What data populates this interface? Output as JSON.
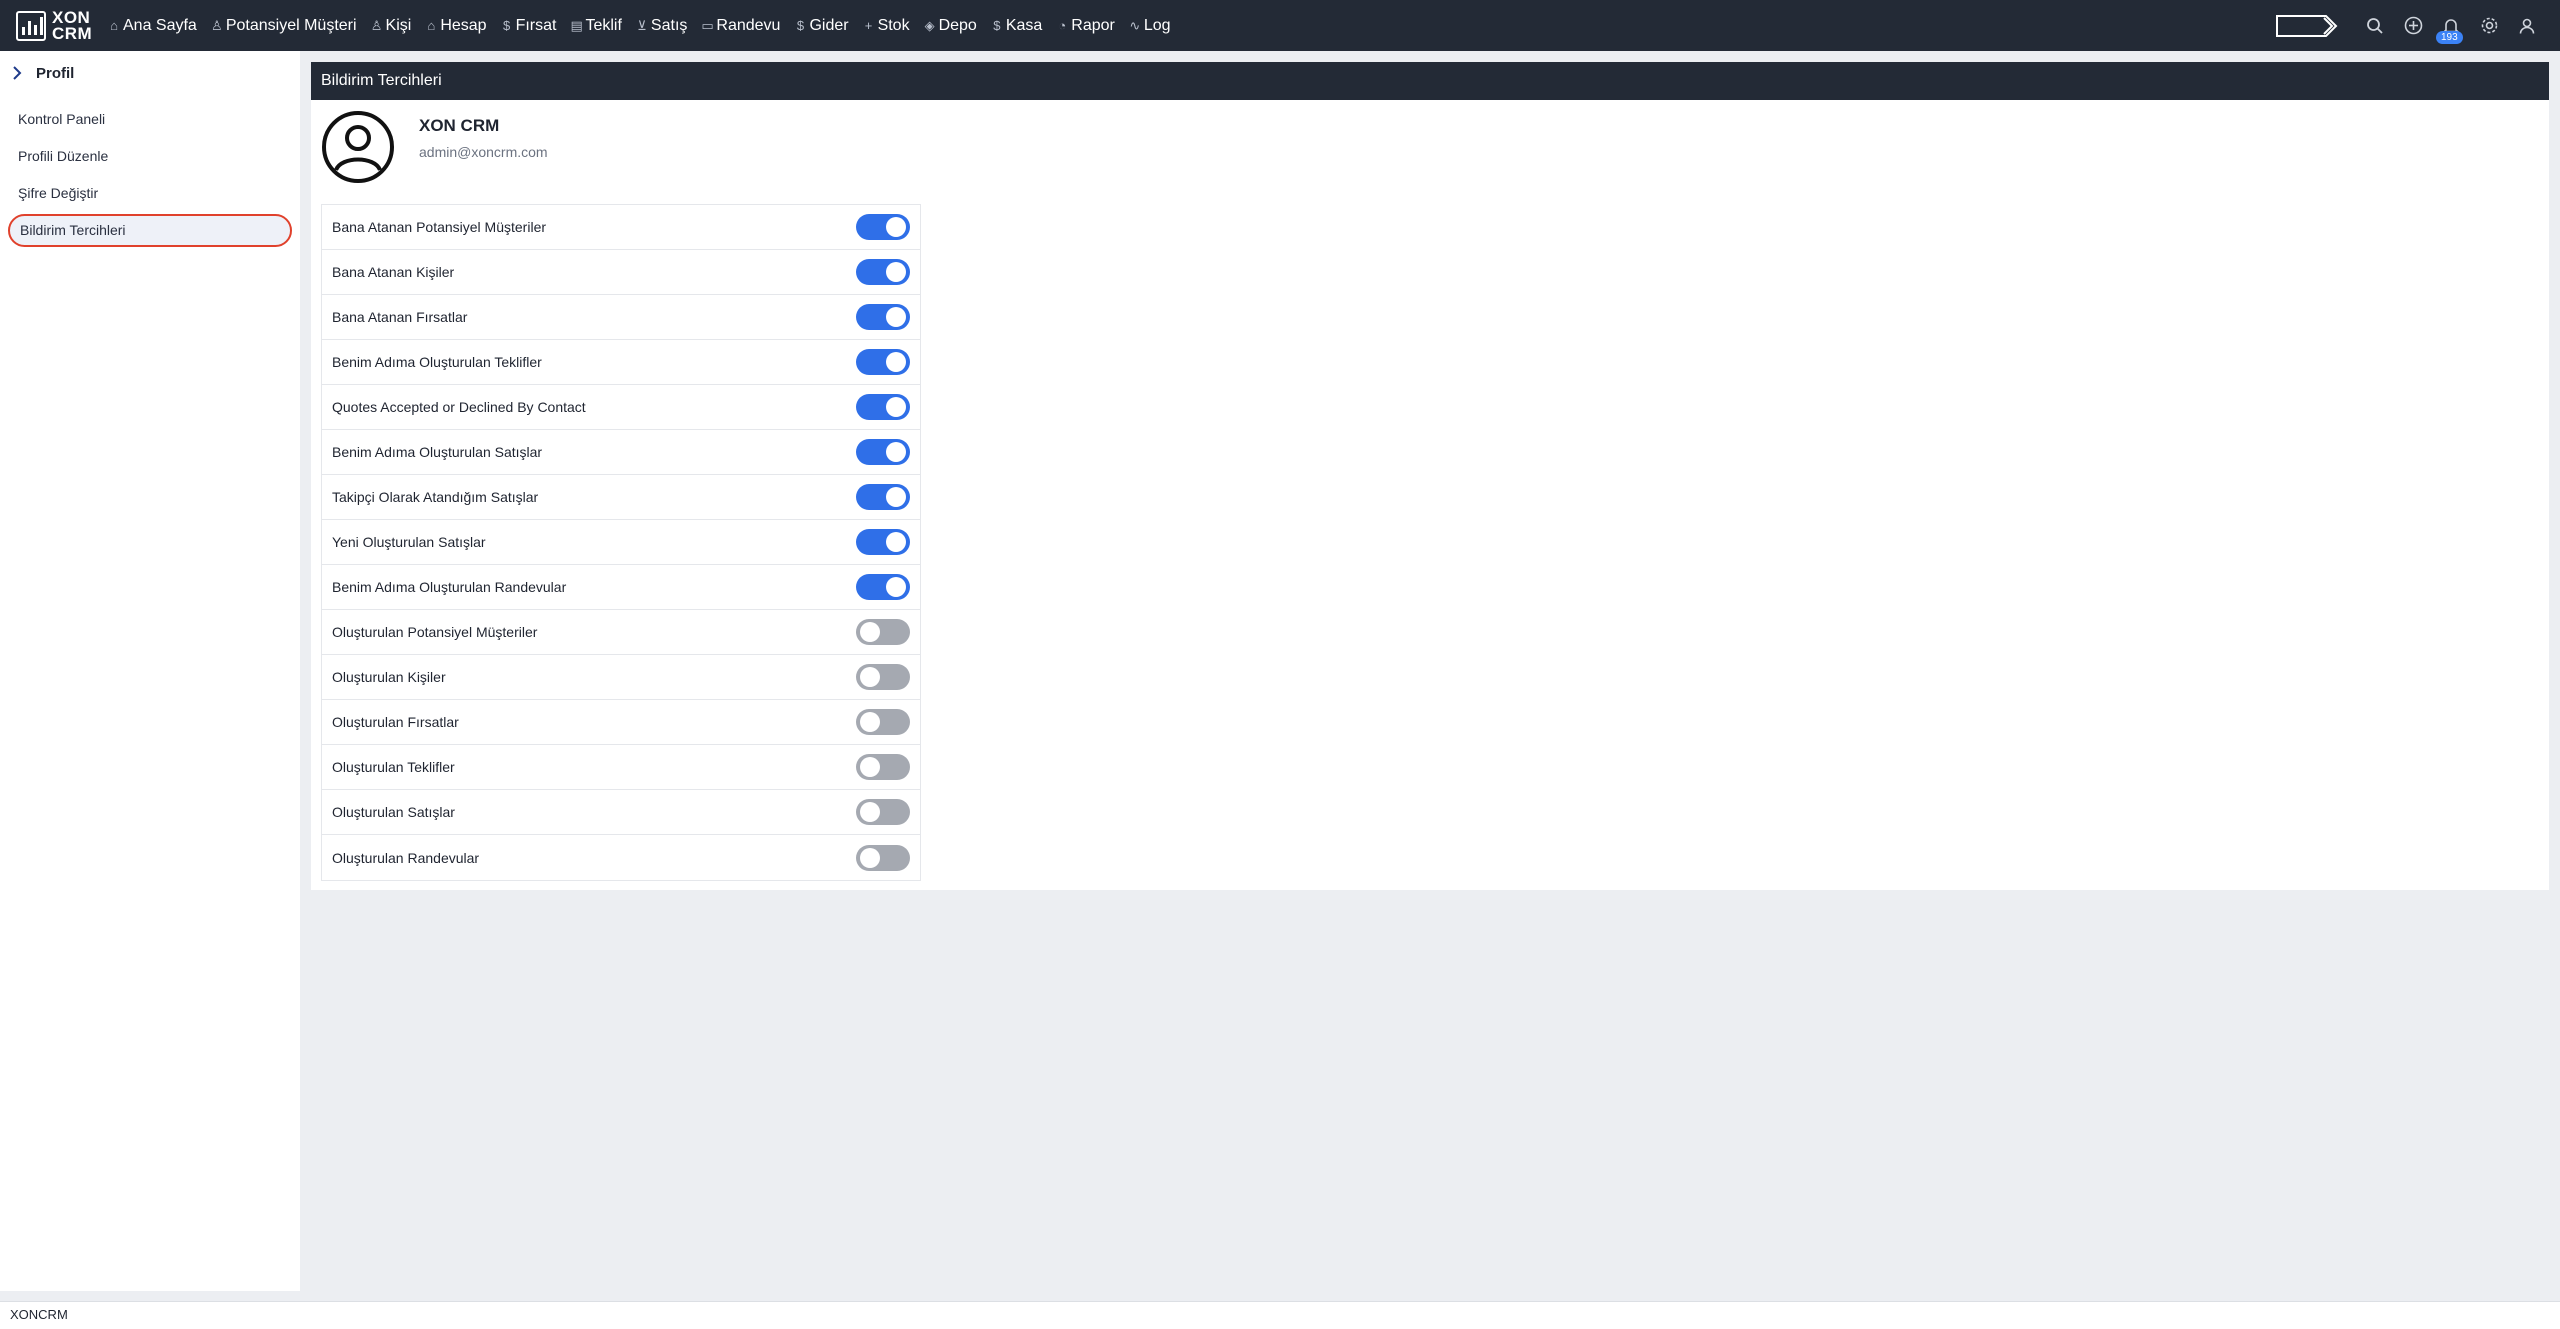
{
  "brand": {
    "line1": "XON",
    "line2": "CRM"
  },
  "nav": [
    {
      "label": "Ana Sayfa",
      "icon": "⌂",
      "name": "home"
    },
    {
      "label": "Potansiyel Müşteri",
      "icon": "♙",
      "name": "leads"
    },
    {
      "label": "Kişi",
      "icon": "♙",
      "name": "contacts"
    },
    {
      "label": "Hesap",
      "icon": "⌂",
      "name": "accounts"
    },
    {
      "label": "Fırsat",
      "icon": "$",
      "name": "opportunities"
    },
    {
      "label": "Teklif",
      "icon": "▤",
      "name": "quotes"
    },
    {
      "label": "Satış",
      "icon": "⊻",
      "name": "sales"
    },
    {
      "label": "Randevu",
      "icon": "▭",
      "name": "appointments"
    },
    {
      "label": "Gider",
      "icon": "$",
      "name": "expenses"
    },
    {
      "label": "Stok",
      "icon": "+",
      "name": "stock"
    },
    {
      "label": "Depo",
      "icon": "◈",
      "name": "warehouse"
    },
    {
      "label": "Kasa",
      "icon": "$",
      "name": "cash"
    },
    {
      "label": "Rapor",
      "icon": "◔",
      "name": "reports"
    },
    {
      "label": "Log",
      "icon": "∿",
      "name": "log"
    }
  ],
  "notifications": {
    "count": "193"
  },
  "sidebar": {
    "title": "Profil",
    "items": [
      {
        "label": "Kontrol Paneli",
        "active": false
      },
      {
        "label": "Profili Düzenle",
        "active": false
      },
      {
        "label": "Şifre Değiştir",
        "active": false
      },
      {
        "label": "Bildirim Tercihleri",
        "active": true
      }
    ]
  },
  "panel": {
    "title": "Bildirim Tercihleri"
  },
  "profile": {
    "name": "XON CRM",
    "email": "admin@xoncrm.com"
  },
  "preferences": [
    {
      "label": "Bana Atanan Potansiyel Müşteriler",
      "enabled": true
    },
    {
      "label": "Bana Atanan Kişiler",
      "enabled": true
    },
    {
      "label": "Bana Atanan Fırsatlar",
      "enabled": true
    },
    {
      "label": "Benim Adıma Oluşturulan Teklifler",
      "enabled": true
    },
    {
      "label": "Quotes Accepted or Declined By Contact",
      "enabled": true
    },
    {
      "label": "Benim Adıma Oluşturulan Satışlar",
      "enabled": true
    },
    {
      "label": "Takipçi Olarak Atandığım Satışlar",
      "enabled": true
    },
    {
      "label": "Yeni Oluşturulan Satışlar",
      "enabled": true
    },
    {
      "label": "Benim Adıma Oluşturulan Randevular",
      "enabled": true
    },
    {
      "label": "Oluşturulan Potansiyel Müşteriler",
      "enabled": false
    },
    {
      "label": "Oluşturulan Kişiler",
      "enabled": false
    },
    {
      "label": "Oluşturulan Fırsatlar",
      "enabled": false
    },
    {
      "label": "Oluşturulan Teklifler",
      "enabled": false
    },
    {
      "label": "Oluşturulan Satışlar",
      "enabled": false
    },
    {
      "label": "Oluşturulan Randevular",
      "enabled": false
    }
  ],
  "footer": {
    "text": "XONCRM"
  },
  "colors": {
    "accent": "#2f6fe8",
    "header": "#232a36",
    "active_outline": "#e0412c",
    "toggle_off": "#a5a9b1"
  }
}
